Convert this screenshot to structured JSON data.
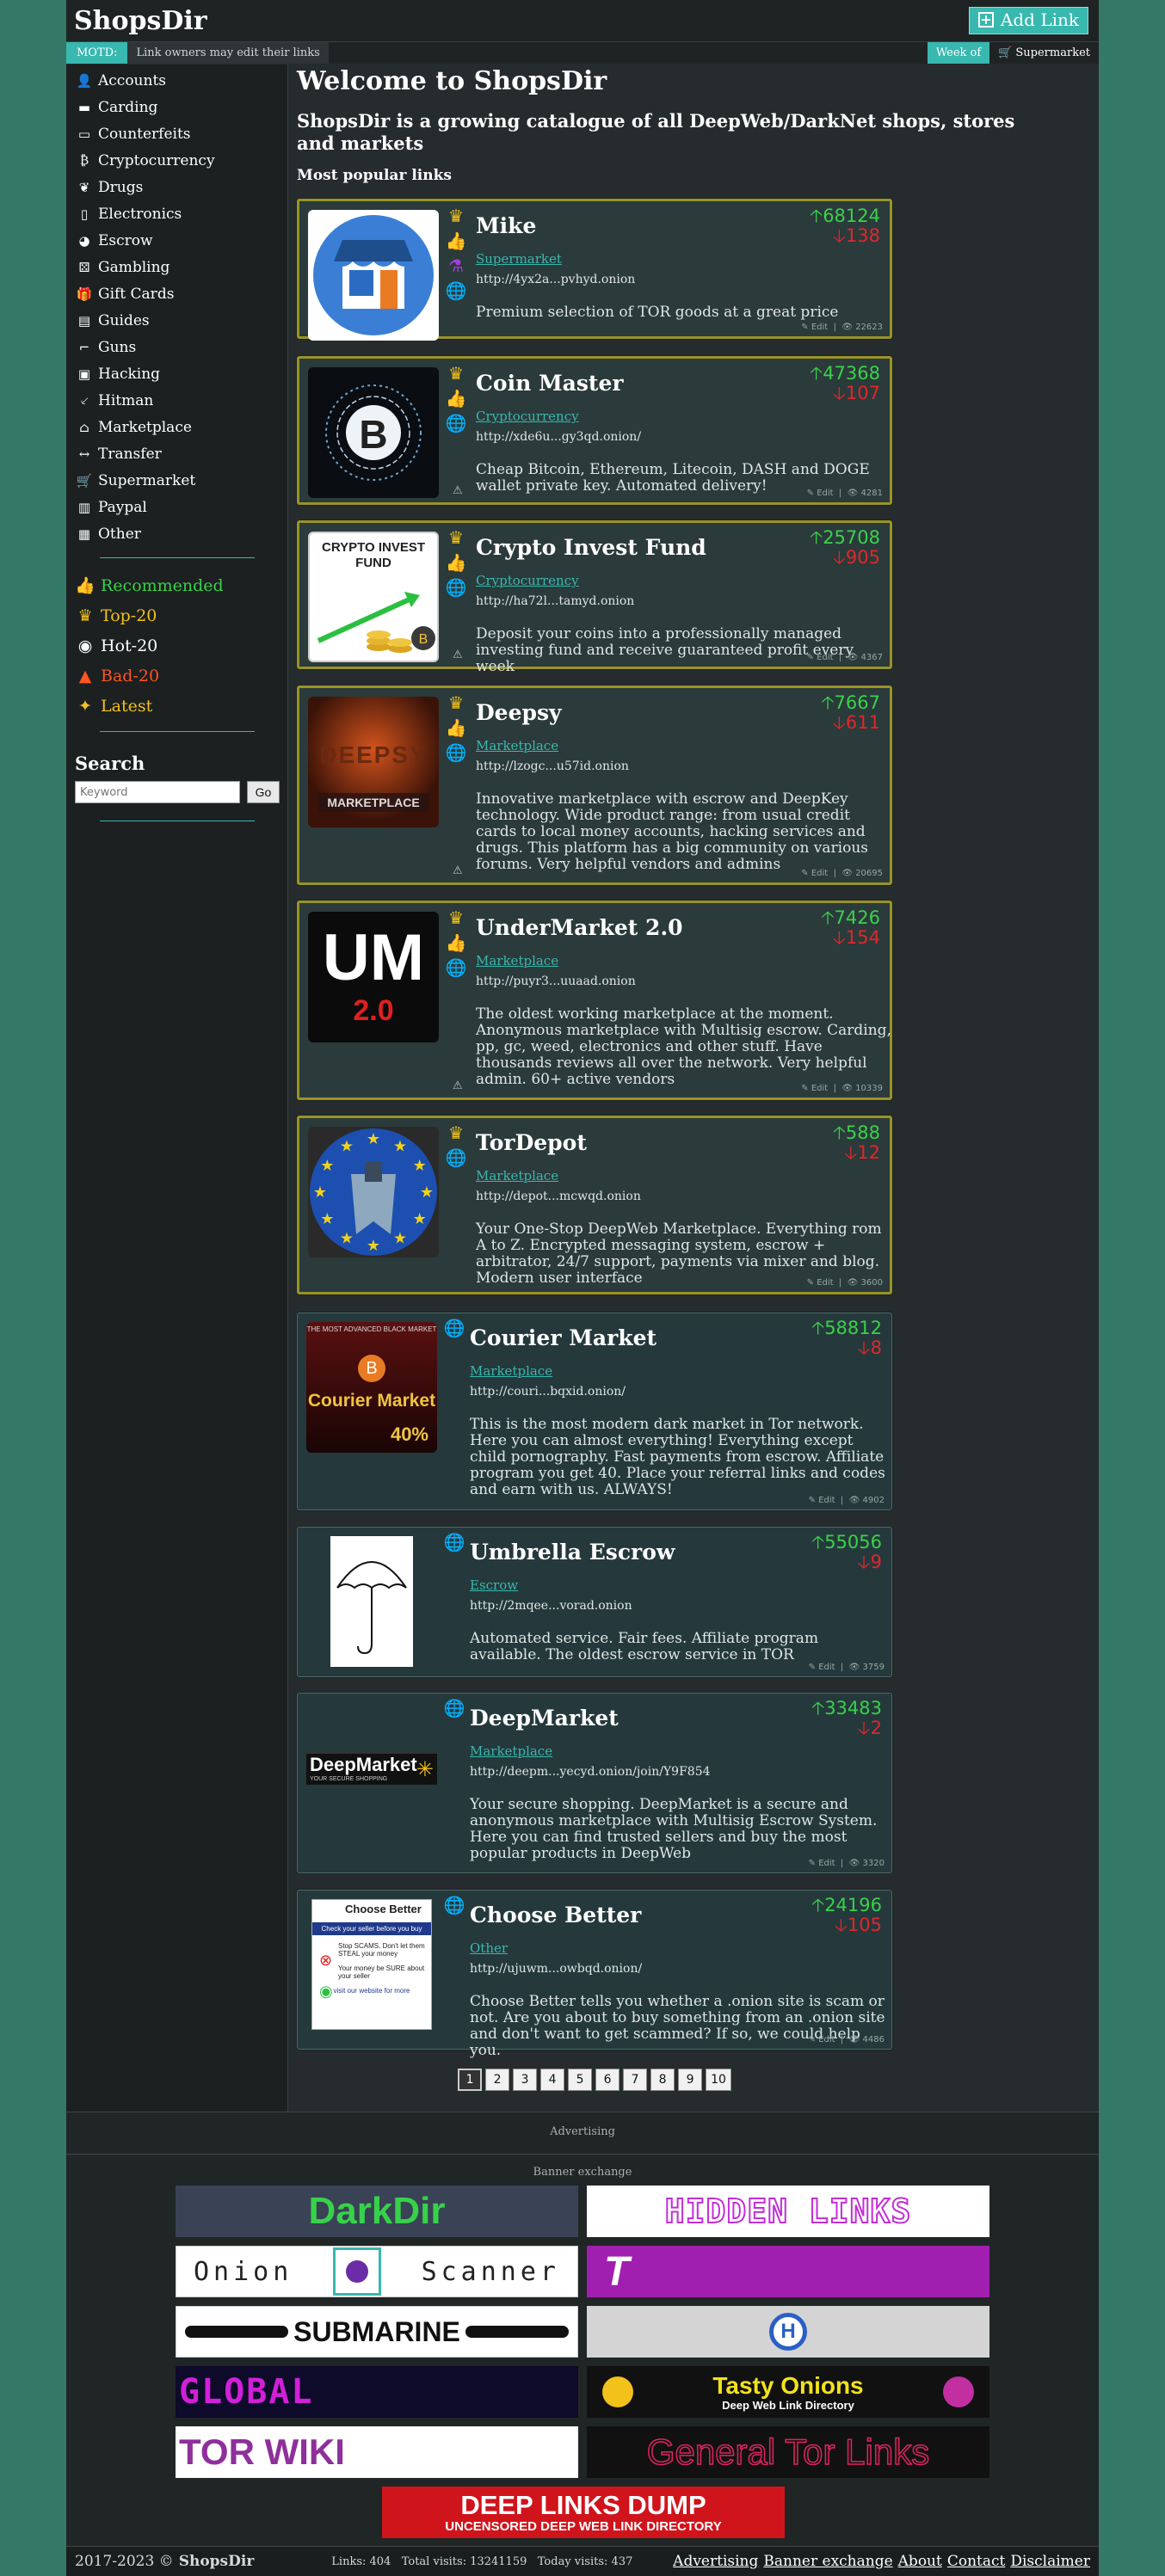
{
  "header": {
    "logo": "ShopsDir",
    "add_link": "Add Link",
    "motd_label": "MOTD:",
    "motd_text": "Link owners may edit their links",
    "week_label": "Week of",
    "week_value": "Supermarket"
  },
  "sidebar": {
    "categories": [
      {
        "label": "Accounts",
        "icon": "user-icon"
      },
      {
        "label": "Carding",
        "icon": "credit-card-icon"
      },
      {
        "label": "Counterfeits",
        "icon": "money-icon"
      },
      {
        "label": "Cryptocurrency",
        "icon": "bitcoin-icon"
      },
      {
        "label": "Drugs",
        "icon": "leaf-icon"
      },
      {
        "label": "Electronics",
        "icon": "mobile-icon"
      },
      {
        "label": "Escrow",
        "icon": "piggy-bank-icon"
      },
      {
        "label": "Gambling",
        "icon": "dice-icon"
      },
      {
        "label": "Gift Cards",
        "icon": "gift-icon"
      },
      {
        "label": "Guides",
        "icon": "book-icon"
      },
      {
        "label": "Guns",
        "icon": "gun-icon"
      },
      {
        "label": "Hacking",
        "icon": "file-code-icon"
      },
      {
        "label": "Hitman",
        "icon": "knife-icon"
      },
      {
        "label": "Marketplace",
        "icon": "store-icon"
      },
      {
        "label": "Transfer",
        "icon": "arrows-horizontal-icon"
      },
      {
        "label": "Supermarket",
        "icon": "cart-icon"
      },
      {
        "label": "Paypal",
        "icon": "wallet-icon"
      },
      {
        "label": "Other",
        "icon": "box-icon"
      }
    ],
    "special": [
      {
        "label": "Recommended",
        "color": "#3ad14a",
        "icon": "thumbs-up-icon"
      },
      {
        "label": "Top-20",
        "color": "#f2c21b",
        "icon": "crown-icon"
      },
      {
        "label": "Hot-20",
        "color": "#ffffff",
        "icon": "hot-icon"
      },
      {
        "label": "Bad-20",
        "color": "#ff5522",
        "icon": "fire-icon"
      },
      {
        "label": "Latest",
        "color": "#f2c21b",
        "icon": "sparkle-icon"
      }
    ],
    "search_title": "Search",
    "search_placeholder": "Keyword",
    "search_button": "Go"
  },
  "main": {
    "welcome": "Welcome to ShopsDir",
    "tagline": "ShopsDir is a growing catalogue of all DeepWeb/DarkNet shops, stores and markets",
    "popular": "Most popular links"
  },
  "listings": [
    {
      "title": "Mike",
      "category": "Supermarket",
      "url": "http://4yx2a...pvhyd.onion",
      "desc": "Premium selection of TOR goods at a great price",
      "up": "68124",
      "down": "138",
      "views": "22623",
      "featured": true,
      "badges": [
        "crown-icon",
        "thumbs-up-icon",
        "flask-icon",
        "globe-icon"
      ],
      "warn": false
    },
    {
      "title": "Coin Master",
      "category": "Cryptocurrency",
      "url": "http://xde6u...gy3qd.onion/",
      "desc": "Cheap Bitcoin, Ethereum, Litecoin, DASH and DOGE wallet private key. Automated delivery!",
      "up": "47368",
      "down": "107",
      "views": "4281",
      "featured": true,
      "badges": [
        "crown-icon",
        "thumbs-up-icon",
        "globe-icon"
      ],
      "warn": true
    },
    {
      "title": "Crypto Invest Fund",
      "category": "Cryptocurrency",
      "url": "http://ha72l...tamyd.onion",
      "desc": "Deposit your coins into a professionally managed investing fund and receive guaranteed profit every week",
      "up": "25708",
      "down": "905",
      "views": "4367",
      "featured": true,
      "badges": [
        "crown-icon",
        "thumbs-up-icon",
        "globe-icon"
      ],
      "warn": true
    },
    {
      "title": "Deepsy",
      "category": "Marketplace",
      "url": "http://lzogc...u57id.onion",
      "desc": "Innovative marketplace with escrow and DeepKey technology. Wide product range: from usual credit cards to local money accounts, hacking services and drugs. This platform has a big community on various forums. Very helpful vendors and admins",
      "up": "7667",
      "down": "611",
      "views": "20695",
      "featured": true,
      "badges": [
        "crown-icon",
        "thumbs-up-icon",
        "globe-icon"
      ],
      "warn": true
    },
    {
      "title": "UnderMarket 2.0",
      "category": "Marketplace",
      "url": "http://puyr3...uuaad.onion",
      "desc": "The oldest working marketplace at the moment. Anonymous marketplace with Multisig escrow. Carding, pp, gc, weed, electronics and other stuff. Have thousands reviews all over the network. Very helpful admin. 60+ active vendors",
      "up": "7426",
      "down": "154",
      "views": "10339",
      "featured": true,
      "badges": [
        "crown-icon",
        "thumbs-up-icon",
        "globe-icon"
      ],
      "warn": true
    },
    {
      "title": "TorDepot",
      "category": "Marketplace",
      "url": "http://depot...mcwqd.onion",
      "desc": "Your One-Stop DeepWeb Marketplace. Everything rom A to Z. Encrypted messaging system, escrow + arbitrator, 24/7 support, payments via mixer and blog. Modern user interface",
      "up": "588",
      "down": "12",
      "views": "3600",
      "featured": true,
      "badges": [
        "crown-icon",
        "globe-icon"
      ],
      "warn": false
    },
    {
      "title": "Courier Market",
      "category": "Marketplace",
      "url": "http://couri...bqxid.onion/",
      "desc": "This is the most modern dark market in Tor network. Here you can almost everything! Everything except child pornography. Fast payments from escrow. Affiliate program you get 40. Place your referral links and codes and earn with us. ALWAYS!",
      "up": "58812",
      "down": "8",
      "views": "4902",
      "featured": false,
      "badges": [
        "globe-icon"
      ],
      "warn": false
    },
    {
      "title": "Umbrella Escrow",
      "category": "Escrow",
      "url": "http://2mqee...vorad.onion",
      "desc": "Automated service. Fair fees. Affiliate program available. The oldest escrow service in TOR",
      "up": "55056",
      "down": "9",
      "views": "3759",
      "featured": false,
      "badges": [
        "globe-icon"
      ],
      "warn": false
    },
    {
      "title": "DeepMarket",
      "category": "Marketplace",
      "url": "http://deepm...yecyd.onion/join/Y9F854",
      "desc": "Your secure shopping. DeepMarket is a secure and anonymous marketplace with Multisig Escrow System. Here you can find trusted sellers and buy the most popular products in DeepWeb",
      "up": "33483",
      "down": "2",
      "views": "3320",
      "featured": false,
      "badges": [
        "globe-icon"
      ],
      "warn": false
    },
    {
      "title": "Choose Better",
      "category": "Other",
      "url": "http://ujuwm...owbqd.onion/",
      "desc": "Choose Better tells you whether a .onion site is scam or not. Are you about to buy something from an .onion site and don't want to get scammed? If so, we could help you.",
      "up": "24196",
      "down": "105",
      "views": "4486",
      "featured": false,
      "badges": [
        "globe-icon"
      ],
      "warn": false
    }
  ],
  "thumb_text": {
    "crypto_fund_1": "CRYPTO INVEST",
    "crypto_fund_2": "FUND",
    "deepsy_1": "DEEPSY",
    "deepsy_2": "MARKETPLACE",
    "um_1": "UM",
    "um_2": "2.0",
    "courier_1": "THE MOST ADVANCED BLACK MARKET",
    "courier_2": "Courier Market",
    "courier_3": "40%",
    "deepmarket_1": "DeepMarket",
    "deepmarket_2": "YOUR SECURE SHOPPING",
    "choose_1": "Choose Better",
    "choose_2": "Check your seller before you buy",
    "choose_3": "Stop SCAMS. Don't let them STEAL your money",
    "choose_4": "Your money be SURE about your seller",
    "choose_5": "visit our website for more"
  },
  "edit_label": "Edit",
  "pagination": [
    "1",
    "2",
    "3",
    "4",
    "5",
    "6",
    "7",
    "8",
    "9",
    "10"
  ],
  "footer": {
    "advertising": "Advertising",
    "banner_exchange": "Banner exchange",
    "banners": [
      {
        "text": "DarkDir",
        "name": "darkdir-banner"
      },
      {
        "text": "HIDDEN LINKS",
        "name": "hidden-links-banner"
      },
      {
        "text": "Onion",
        "text2": "Scanner",
        "name": "onion-scanner-banner"
      },
      {
        "text": "T",
        "name": "t-banner"
      },
      {
        "text": "SUBMARINE",
        "name": "submarine-banner"
      },
      {
        "text": "",
        "name": "h-search-banner"
      },
      {
        "text": "GLOBAL",
        "name": "global-banner"
      },
      {
        "text": "Tasty Onions",
        "text2": "Deep Web Link Directory",
        "name": "tasty-onions-banner"
      },
      {
        "text": "TOR WIKI",
        "name": "tor-wiki-banner"
      },
      {
        "text": "General Tor Links",
        "name": "general-tor-links-banner"
      },
      {
        "text": "DEEP LINKS DUMP",
        "text2": "UNCENSORED DEEP WEB LINK DIRECTORY",
        "name": "deep-links-dump-banner"
      }
    ],
    "copyright_years": "2017-2023 ©",
    "copyright_name": "ShopsDir",
    "stats": "Links: 404   Total visits: 13241159   Today visits: 437",
    "links": [
      "Advertising",
      "Banner exchange",
      "About",
      "Contact",
      "Disclaimer"
    ]
  }
}
